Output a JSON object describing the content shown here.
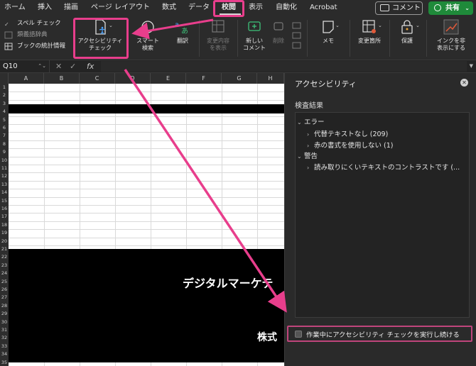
{
  "tabs": [
    "ホーム",
    "挿入",
    "描画",
    "ページ レイアウト",
    "数式",
    "データ",
    "校閲",
    "表示",
    "自動化",
    "Acrobat"
  ],
  "active_tab": "校閲",
  "top_buttons": {
    "comment": "コメント",
    "share": "共有"
  },
  "ribbon": {
    "spell_check": "スペル チェック",
    "thesaurus": "類義語辞典",
    "workbook_stats": "ブックの統計情報",
    "accessibility_line1": "アクセシビリティ",
    "accessibility_line2": "チェック",
    "smart_lookup_line1": "スマート",
    "smart_lookup_line2": "検索",
    "translate": "翻訳",
    "show_changes_line1": "変更内容",
    "show_changes_line2": "を表示",
    "new_comment_line1": "新しい",
    "new_comment_line2": "コメント",
    "delete": "削除",
    "notes": "メモ",
    "changes_location": "変更箇所",
    "protect": "保護",
    "hide_ink_line1": "インクを非",
    "hide_ink_line2": "表示にする"
  },
  "formula_bar": {
    "name_box": "Q10",
    "fx": "fx",
    "value": ""
  },
  "sheet": {
    "columns": [
      "A",
      "B",
      "C",
      "D",
      "E",
      "F",
      "G",
      "H"
    ],
    "rows": [
      "1",
      "2",
      "3",
      "4",
      "5",
      "6",
      "7",
      "8",
      "9",
      "10",
      "11",
      "12",
      "13",
      "14",
      "15",
      "16",
      "17",
      "18",
      "19",
      "20",
      "21",
      "22",
      "23",
      "24",
      "25",
      "26",
      "27",
      "28",
      "29",
      "30",
      "31",
      "32",
      "33",
      "34",
      "35"
    ],
    "text_1": "デジタルマーケテ",
    "text_2": "株式"
  },
  "pane": {
    "title": "アクセシビリティ",
    "results_label": "検査結果",
    "errors_label": "エラー",
    "error_items": [
      "代替テキストなし (209)",
      "赤の書式を使用しない (1)"
    ],
    "warnings_label": "警告",
    "warning_items": [
      "読み取りにくいテキストのコントラストです (..."
    ],
    "keep_running_checkbox": "作業中にアクセシビリティ チェックを実行し続ける",
    "keep_running_checked": false
  },
  "colors": {
    "highlight": "#e83e8c",
    "share_green": "#1f8a3a"
  }
}
